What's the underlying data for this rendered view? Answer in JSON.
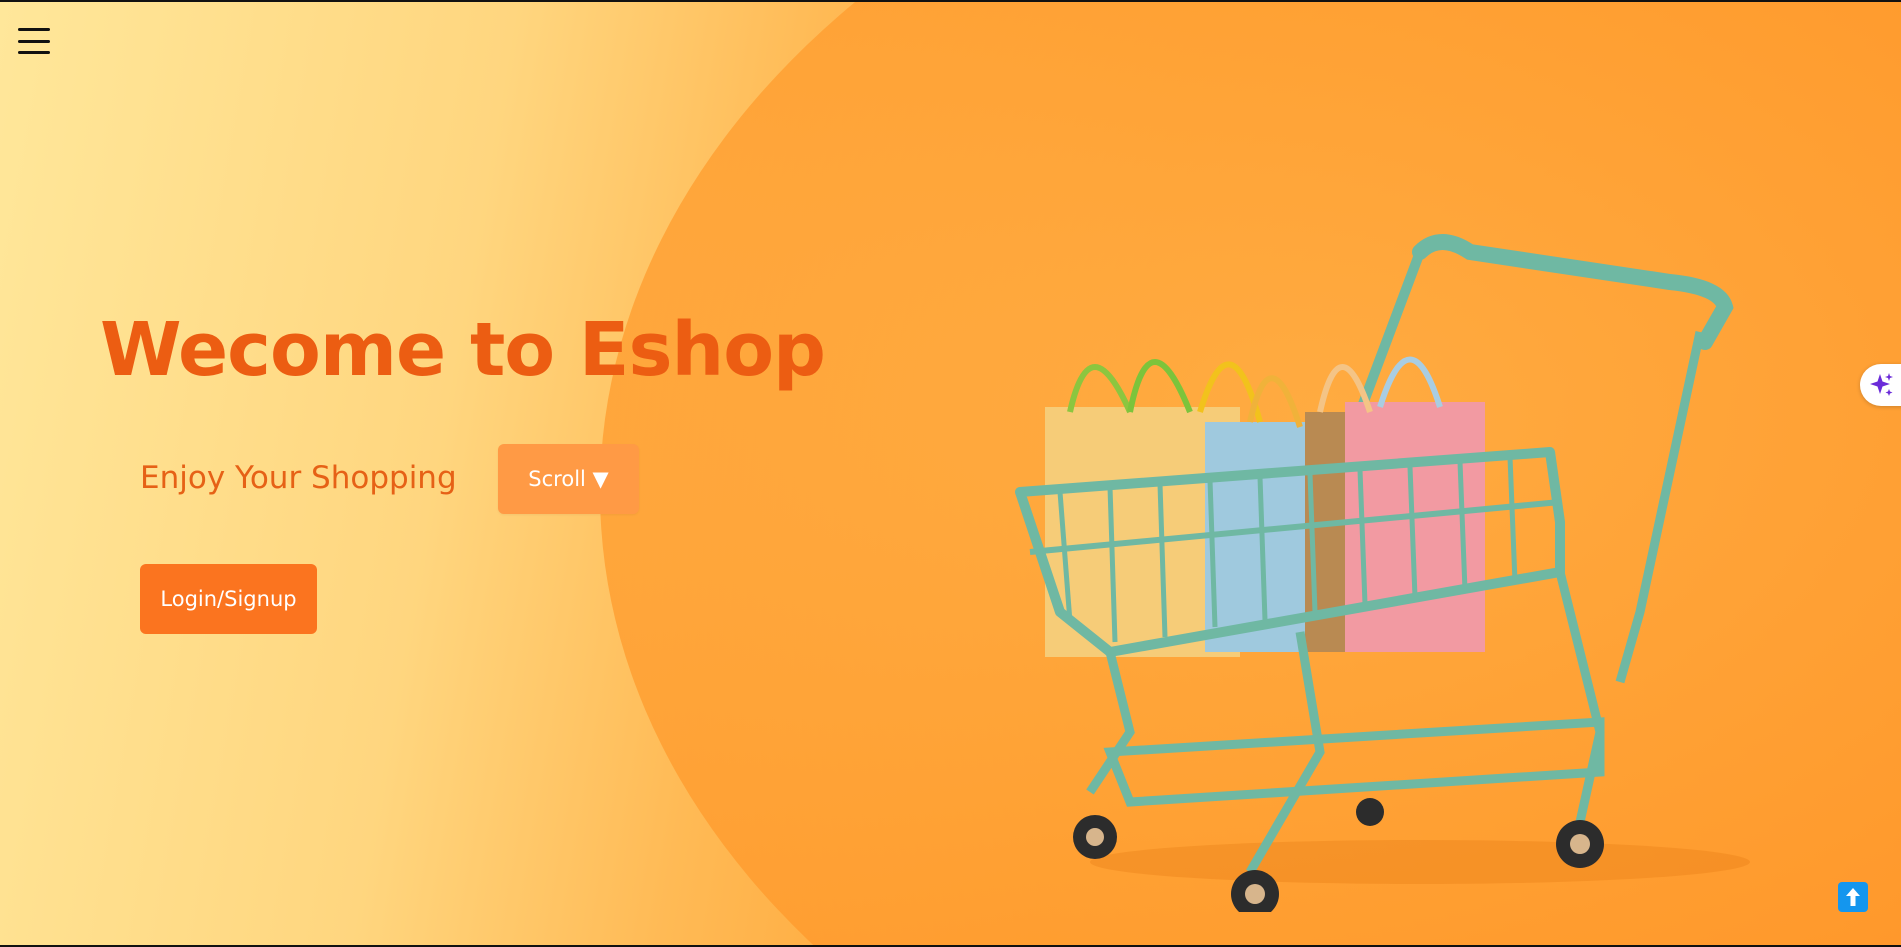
{
  "hero": {
    "title": "Wecome to Eshop",
    "subtitle": "Enjoy Your Shopping",
    "scroll_label": "Scroll ▼",
    "login_label": "Login/Signup"
  },
  "icons": {
    "menu": "hamburger-menu-icon",
    "ai": "sparkle-icon",
    "back_to_top": "arrow-up-icon",
    "hero_image": "shopping-cart-illustration"
  },
  "colors": {
    "title": "#ec5d12",
    "scroll_button": "#ff9a45",
    "login_button": "#fb741f",
    "back_to_top": "#1496ee",
    "sparkle": "#6b2bd9"
  }
}
